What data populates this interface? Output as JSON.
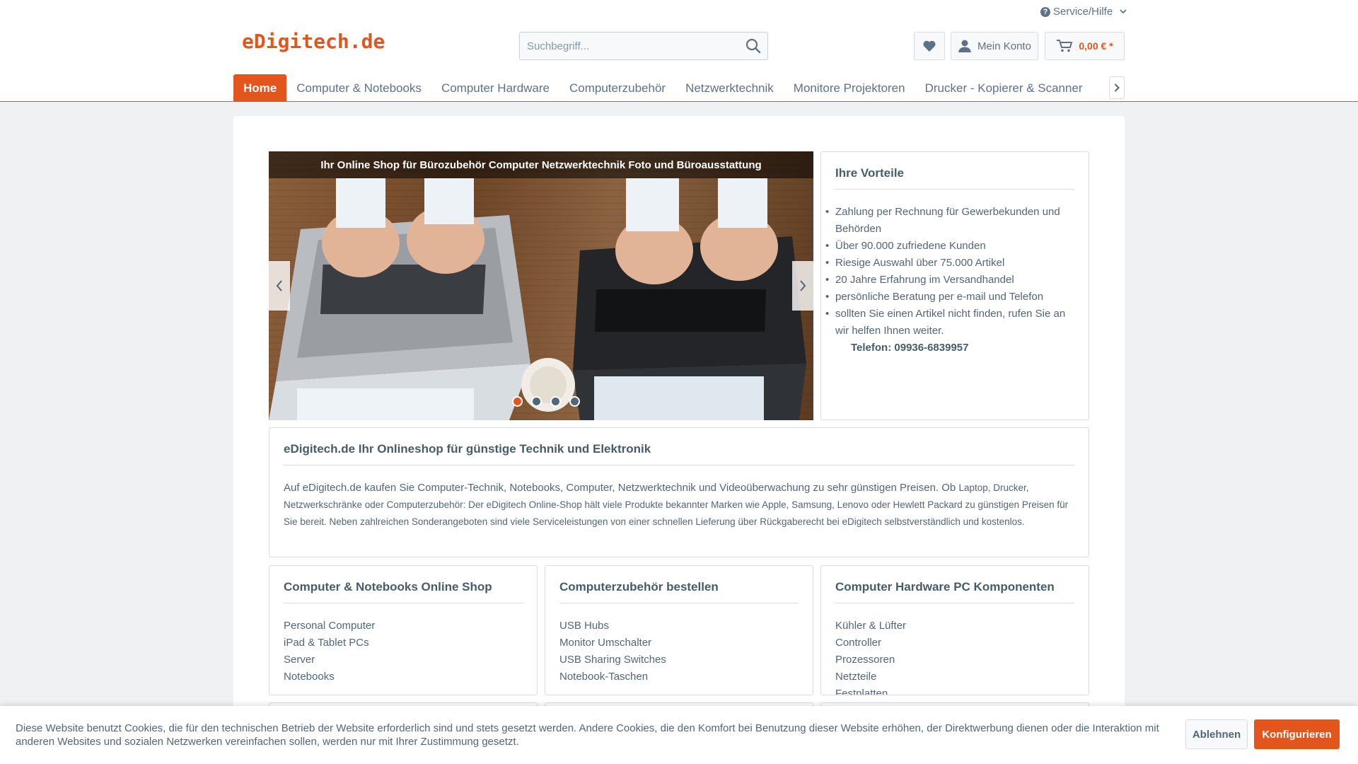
{
  "header": {
    "logo": "eDigitech.de",
    "service_label": "Service/Hilfe",
    "search_placeholder": "Suchbegriff...",
    "account_label": "Mein Konto",
    "cart_amount": "0,00 € *"
  },
  "nav": {
    "items": [
      "Home",
      "Computer & Notebooks",
      "Computer Hardware",
      "Computerzubehör",
      "Netzwerktechnik",
      "Monitore Projektoren",
      "Drucker - Kopierer & Scanner"
    ]
  },
  "slider": {
    "banner": "Ihr Online Shop für Bürozubehör Computer Netzwerktechnik Foto und Büroausstattung",
    "slide_count": 4,
    "active_slide": 1
  },
  "vorteile": {
    "title": "Ihre Vorteile",
    "items": [
      "Zahlung per Rechnung für Gewerbekunden und Behörden",
      "Über 90.000 zufriedene Kunden",
      "Riesige Auswahl über 75.000 Artikel",
      "20 Jahre Erfahrung im Versandhandel",
      "persönliche Beratung per e-mail und Telefon",
      "sollten Sie einen Artikel nicht finden, rufen Sie an wir helfen Ihnen weiter."
    ],
    "phone": "Telefon:  09936-6839957"
  },
  "about": {
    "title": "eDigitech.de Ihr Onlineshop für günstige Technik und Elektronik",
    "text_main": "Auf eDigitech.de kaufen Sie Computer-Technik, Notebooks, Computer, Netzwerktechnik und Videoüberwachung zu sehr günstigen Preisen. Ob",
    "text_small": "Laptop, Drucker, Netzwerkschränke  oder Computerzubehör: Der eDigitech Online-Shop hält viele Produkte bekannter Marken wie Apple, Samsung, Lenovo oder Hewlett Packard zu günstigen Preisen für Sie bereit. Neben zahlreichen Sonderangeboten sind viele Serviceleistungen von einer schnellen Lieferung über Rückgaberecht bei eDigitech selbstverständlich und kostenlos."
  },
  "categories": [
    {
      "title": "Computer & Notebooks Online Shop",
      "links": [
        "Personal Computer",
        "iPad & Tablet PCs",
        "Server",
        "Notebooks"
      ]
    },
    {
      "title": "Computerzubehör bestellen",
      "links": [
        "USB Hubs",
        "Monitor Umschalter",
        "USB Sharing Switches",
        "Notebook-Taschen"
      ]
    },
    {
      "title": "Computer Hardware PC Komponenten",
      "links": [
        "Kühler & Lüfter",
        "Controller",
        "Prozessoren",
        "Netzteile",
        "Festplatten"
      ]
    }
  ],
  "cookie": {
    "text": "Diese Website benutzt Cookies, die für den technischen Betrieb der Website erforderlich sind und stets gesetzt werden. Andere Cookies, die den Komfort bei Benutzung dieser Website erhöhen, der Direktwerbung dienen oder die Interaktion mit anderen Websites und sozialen Netzwerken vereinfachen sollen, werden nur mit Ihrer Zustimmung gesetzt.",
    "decline": "Ablehnen",
    "configure": "Konfigurieren"
  },
  "colors": {
    "accent": "#e2561e",
    "text": "#52667a"
  }
}
